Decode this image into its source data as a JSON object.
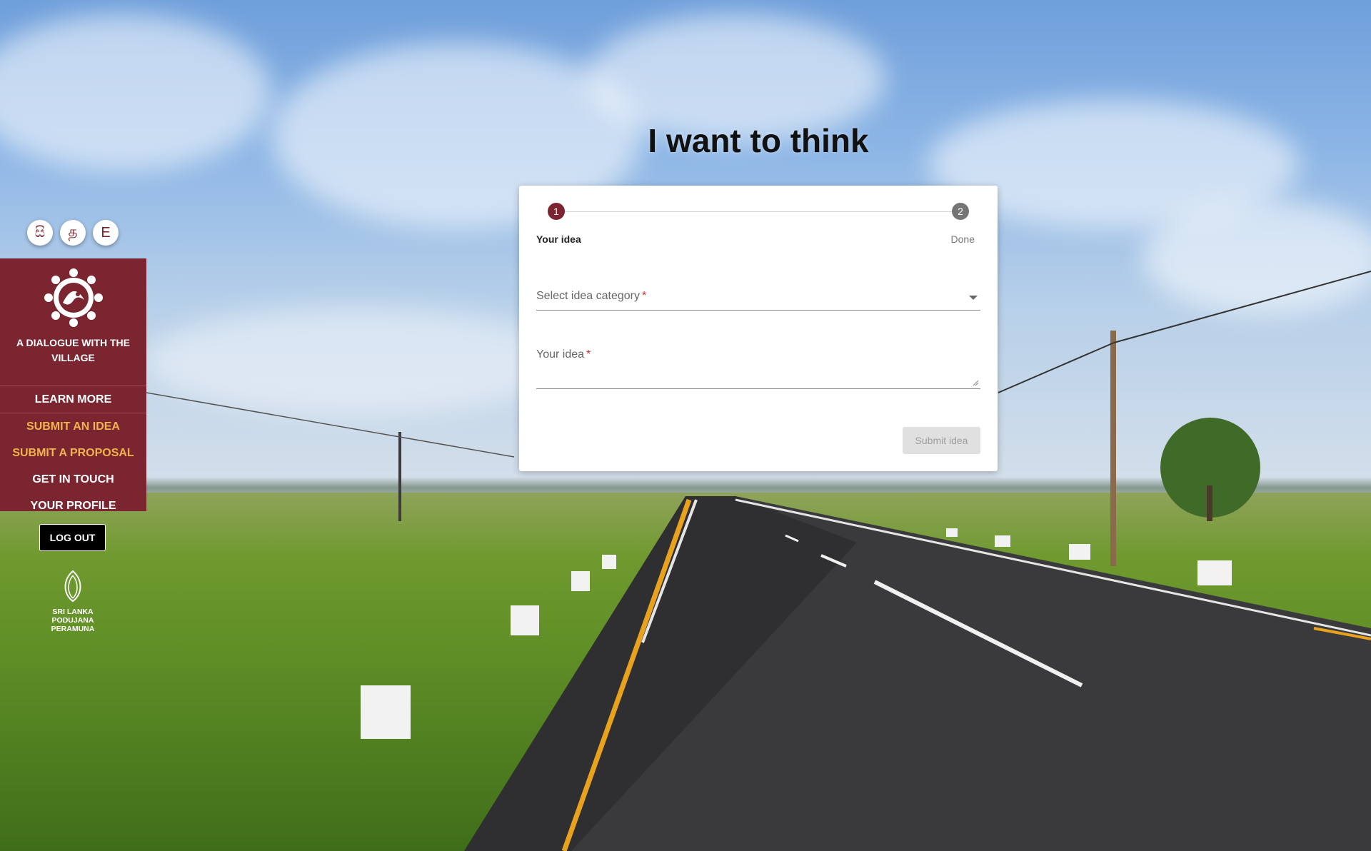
{
  "language_switch": [
    {
      "glyph": "සි"
    },
    {
      "glyph": "த"
    },
    {
      "glyph": "E"
    }
  ],
  "sidebar": {
    "brand_name": "A DIALOGUE WITH THE VILLAGE",
    "menu": [
      {
        "label": "LEARN MORE",
        "highlighted": false
      },
      {
        "label": "SUBMIT AN IDEA",
        "highlighted": true
      },
      {
        "label": "SUBMIT A PROPOSAL",
        "highlighted": true
      },
      {
        "label": "GET IN TOUCH",
        "highlighted": false
      },
      {
        "label": "YOUR PROFILE",
        "highlighted": false
      }
    ],
    "logout_label": "LOG OUT",
    "party_name_lines": [
      "SRI LANKA",
      "PODUJANA",
      "PERAMUNA"
    ]
  },
  "main": {
    "title": "I want to think",
    "stepper": {
      "steps": [
        {
          "number": "1",
          "label": "Your idea",
          "active": true
        },
        {
          "number": "2",
          "label": "Done",
          "active": false
        }
      ]
    },
    "form": {
      "category_label": "Select idea category",
      "idea_label": "Your idea",
      "required_mark": "*",
      "submit_label": "Submit idea",
      "submit_enabled": false
    }
  },
  "colors": {
    "brand": "#7a2530",
    "menu_highlight": "#f2b24c",
    "required": "#d32f2f"
  }
}
